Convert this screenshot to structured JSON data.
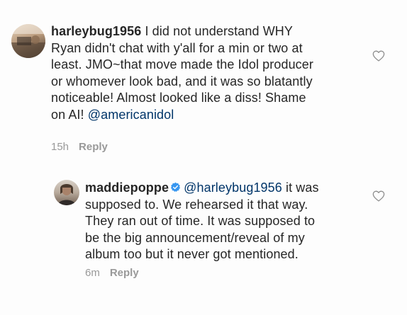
{
  "comments": [
    {
      "username": "harleybug1956",
      "verified": false,
      "lines": [
        " I did not understand WHY",
        "Ryan didn't chat with y'all for a min or two at",
        "least.  JMO~that move made the Idol producer",
        "or whomever look bad, and it was so blatantly",
        "noticeable!  Almost looked like a diss!  Shame",
        "on AI! "
      ],
      "mention": "@americanidol",
      "time": "15h",
      "reply_label": "Reply"
    },
    {
      "username": "maddiepoppe",
      "verified": true,
      "mention": "@harleybug1956",
      "lines": [
        " it was",
        "supposed to. We rehearsed it that way.",
        "They ran out of time. It was supposed to",
        "be the big announcement/reveal of my",
        "album too but it never got mentioned."
      ],
      "time": "6m",
      "reply_label": "Reply"
    }
  ],
  "icons": {
    "like": "heart-outline-icon",
    "verified": "verified-badge-icon"
  },
  "colors": {
    "text": "#262626",
    "mention": "#003569",
    "meta": "#999999",
    "verified": "#3897f0"
  }
}
